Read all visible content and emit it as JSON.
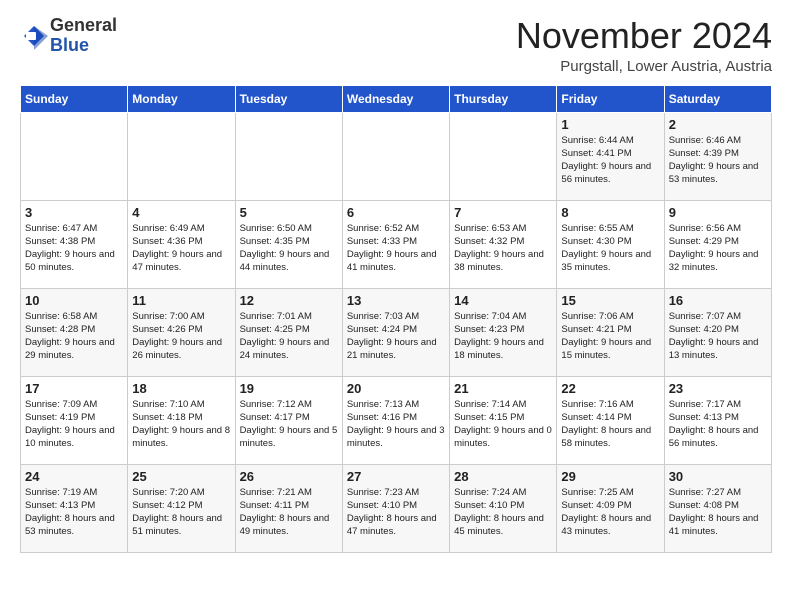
{
  "header": {
    "logo_general": "General",
    "logo_blue": "Blue",
    "month_title": "November 2024",
    "location": "Purgstall, Lower Austria, Austria"
  },
  "weekdays": [
    "Sunday",
    "Monday",
    "Tuesday",
    "Wednesday",
    "Thursday",
    "Friday",
    "Saturday"
  ],
  "weeks": [
    [
      {
        "day": "",
        "info": ""
      },
      {
        "day": "",
        "info": ""
      },
      {
        "day": "",
        "info": ""
      },
      {
        "day": "",
        "info": ""
      },
      {
        "day": "",
        "info": ""
      },
      {
        "day": "1",
        "info": "Sunrise: 6:44 AM\nSunset: 4:41 PM\nDaylight: 9 hours and 56 minutes."
      },
      {
        "day": "2",
        "info": "Sunrise: 6:46 AM\nSunset: 4:39 PM\nDaylight: 9 hours and 53 minutes."
      }
    ],
    [
      {
        "day": "3",
        "info": "Sunrise: 6:47 AM\nSunset: 4:38 PM\nDaylight: 9 hours and 50 minutes."
      },
      {
        "day": "4",
        "info": "Sunrise: 6:49 AM\nSunset: 4:36 PM\nDaylight: 9 hours and 47 minutes."
      },
      {
        "day": "5",
        "info": "Sunrise: 6:50 AM\nSunset: 4:35 PM\nDaylight: 9 hours and 44 minutes."
      },
      {
        "day": "6",
        "info": "Sunrise: 6:52 AM\nSunset: 4:33 PM\nDaylight: 9 hours and 41 minutes."
      },
      {
        "day": "7",
        "info": "Sunrise: 6:53 AM\nSunset: 4:32 PM\nDaylight: 9 hours and 38 minutes."
      },
      {
        "day": "8",
        "info": "Sunrise: 6:55 AM\nSunset: 4:30 PM\nDaylight: 9 hours and 35 minutes."
      },
      {
        "day": "9",
        "info": "Sunrise: 6:56 AM\nSunset: 4:29 PM\nDaylight: 9 hours and 32 minutes."
      }
    ],
    [
      {
        "day": "10",
        "info": "Sunrise: 6:58 AM\nSunset: 4:28 PM\nDaylight: 9 hours and 29 minutes."
      },
      {
        "day": "11",
        "info": "Sunrise: 7:00 AM\nSunset: 4:26 PM\nDaylight: 9 hours and 26 minutes."
      },
      {
        "day": "12",
        "info": "Sunrise: 7:01 AM\nSunset: 4:25 PM\nDaylight: 9 hours and 24 minutes."
      },
      {
        "day": "13",
        "info": "Sunrise: 7:03 AM\nSunset: 4:24 PM\nDaylight: 9 hours and 21 minutes."
      },
      {
        "day": "14",
        "info": "Sunrise: 7:04 AM\nSunset: 4:23 PM\nDaylight: 9 hours and 18 minutes."
      },
      {
        "day": "15",
        "info": "Sunrise: 7:06 AM\nSunset: 4:21 PM\nDaylight: 9 hours and 15 minutes."
      },
      {
        "day": "16",
        "info": "Sunrise: 7:07 AM\nSunset: 4:20 PM\nDaylight: 9 hours and 13 minutes."
      }
    ],
    [
      {
        "day": "17",
        "info": "Sunrise: 7:09 AM\nSunset: 4:19 PM\nDaylight: 9 hours and 10 minutes."
      },
      {
        "day": "18",
        "info": "Sunrise: 7:10 AM\nSunset: 4:18 PM\nDaylight: 9 hours and 8 minutes."
      },
      {
        "day": "19",
        "info": "Sunrise: 7:12 AM\nSunset: 4:17 PM\nDaylight: 9 hours and 5 minutes."
      },
      {
        "day": "20",
        "info": "Sunrise: 7:13 AM\nSunset: 4:16 PM\nDaylight: 9 hours and 3 minutes."
      },
      {
        "day": "21",
        "info": "Sunrise: 7:14 AM\nSunset: 4:15 PM\nDaylight: 9 hours and 0 minutes."
      },
      {
        "day": "22",
        "info": "Sunrise: 7:16 AM\nSunset: 4:14 PM\nDaylight: 8 hours and 58 minutes."
      },
      {
        "day": "23",
        "info": "Sunrise: 7:17 AM\nSunset: 4:13 PM\nDaylight: 8 hours and 56 minutes."
      }
    ],
    [
      {
        "day": "24",
        "info": "Sunrise: 7:19 AM\nSunset: 4:13 PM\nDaylight: 8 hours and 53 minutes."
      },
      {
        "day": "25",
        "info": "Sunrise: 7:20 AM\nSunset: 4:12 PM\nDaylight: 8 hours and 51 minutes."
      },
      {
        "day": "26",
        "info": "Sunrise: 7:21 AM\nSunset: 4:11 PM\nDaylight: 8 hours and 49 minutes."
      },
      {
        "day": "27",
        "info": "Sunrise: 7:23 AM\nSunset: 4:10 PM\nDaylight: 8 hours and 47 minutes."
      },
      {
        "day": "28",
        "info": "Sunrise: 7:24 AM\nSunset: 4:10 PM\nDaylight: 8 hours and 45 minutes."
      },
      {
        "day": "29",
        "info": "Sunrise: 7:25 AM\nSunset: 4:09 PM\nDaylight: 8 hours and 43 minutes."
      },
      {
        "day": "30",
        "info": "Sunrise: 7:27 AM\nSunset: 4:08 PM\nDaylight: 8 hours and 41 minutes."
      }
    ]
  ]
}
